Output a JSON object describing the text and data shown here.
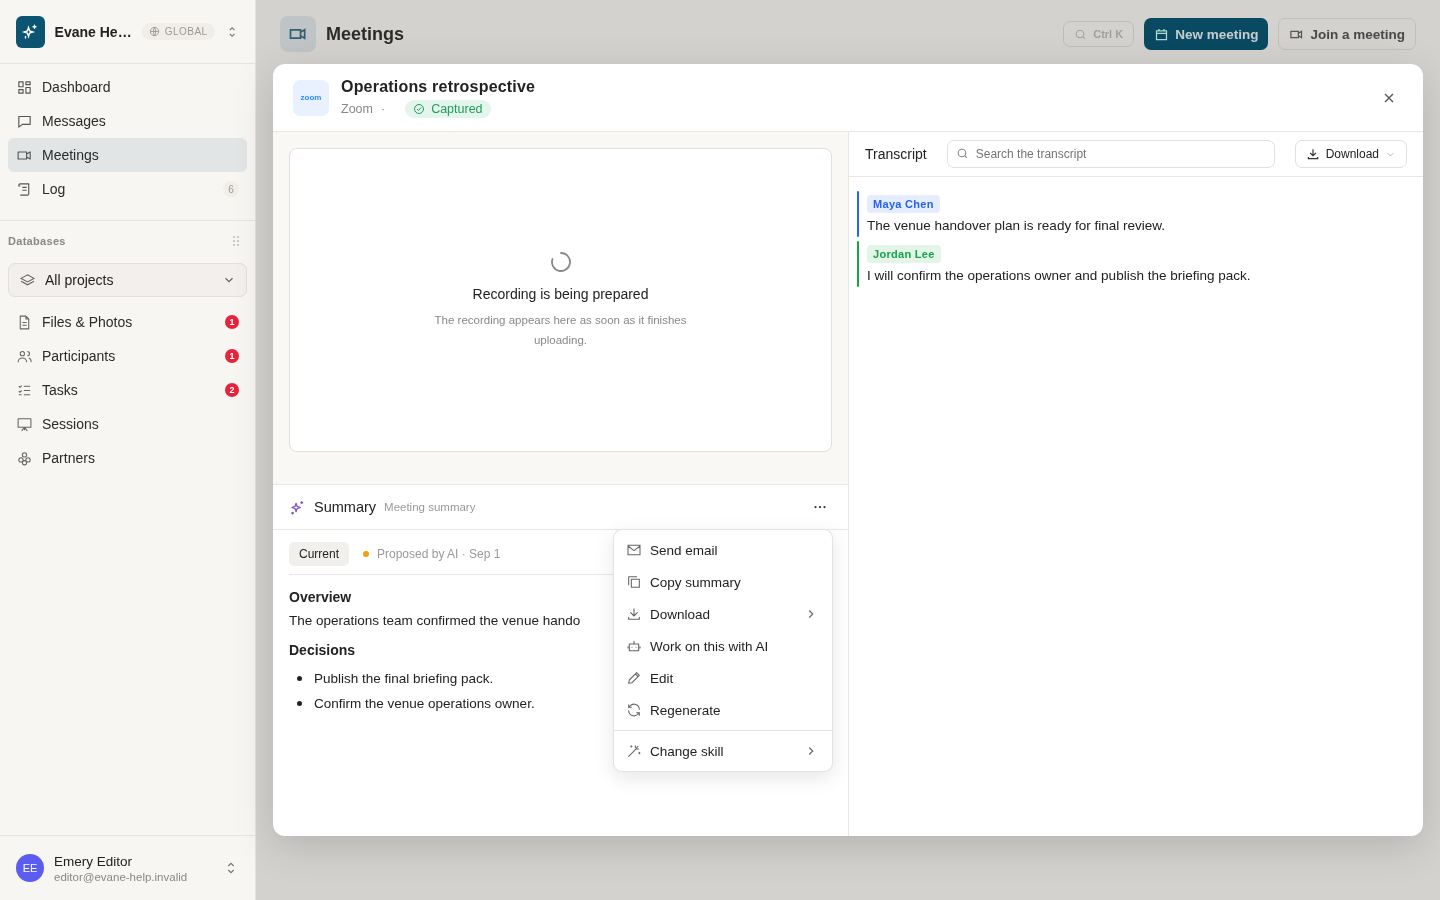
{
  "workspace": {
    "name": "Evane He…",
    "scope": "GLOBAL"
  },
  "nav": [
    {
      "label": "Dashboard",
      "selected": false
    },
    {
      "label": "Messages",
      "selected": false
    },
    {
      "label": "Meetings",
      "selected": true
    },
    {
      "label": "Log",
      "selected": false,
      "count": "6"
    }
  ],
  "databases": {
    "title": "Databases",
    "filter": "All projects",
    "items": [
      {
        "label": "Files & Photos",
        "count": "1",
        "alert": true
      },
      {
        "label": "Participants",
        "count": "1",
        "alert": true
      },
      {
        "label": "Tasks",
        "count": "2",
        "alert": true
      },
      {
        "label": "Sessions"
      },
      {
        "label": "Partners"
      }
    ]
  },
  "user": {
    "initials": "EE",
    "name": "Emery Editor",
    "email": "editor@evane-help.invalid"
  },
  "page": {
    "title": "Meetings",
    "search_hint": "Ctrl K",
    "primary_button": "New meeting",
    "secondary_button": "Join a meeting"
  },
  "modal": {
    "title": "Operations retrospective",
    "logo": "zoom",
    "source": "Zoom",
    "separator": "·",
    "status": "Captured",
    "recording": {
      "title": "Recording is being prepared",
      "message": "The recording appears here as soon as it finishes uploading."
    },
    "summary": {
      "title": "Summary",
      "subtitle": "Meeting summary",
      "version": "Current",
      "proposal": "Proposed by AI · Sep 1",
      "overview": {
        "heading": "Overview",
        "text": "The operations team confirmed the venue hando"
      },
      "decisions": {
        "heading": "Decisions",
        "items": [
          "Publish the final briefing pack.",
          "Confirm the venue operations owner."
        ]
      }
    },
    "menu": {
      "groups": [
        [
          {
            "label": "Send email",
            "submenu": false
          },
          {
            "label": "Copy summary",
            "submenu": false
          },
          {
            "label": "Download",
            "submenu": true
          },
          {
            "label": "Work on this with AI",
            "submenu": false
          },
          {
            "label": "Edit",
            "submenu": false
          },
          {
            "label": "Regenerate",
            "submenu": false
          }
        ],
        [
          {
            "label": "Change skill",
            "submenu": true
          }
        ]
      ]
    }
  },
  "transcript": {
    "title": "Transcript",
    "search_placeholder": "Search the transcript",
    "download": "Download",
    "entries": [
      {
        "speaker": "Maya Chen",
        "color": "#2563eb",
        "text": "The venue handover plan is ready for final review."
      },
      {
        "speaker": "Jordan Lee",
        "color": "#16a34a",
        "text": "I will confirm the operations owner and publish the briefing pack."
      }
    ]
  }
}
